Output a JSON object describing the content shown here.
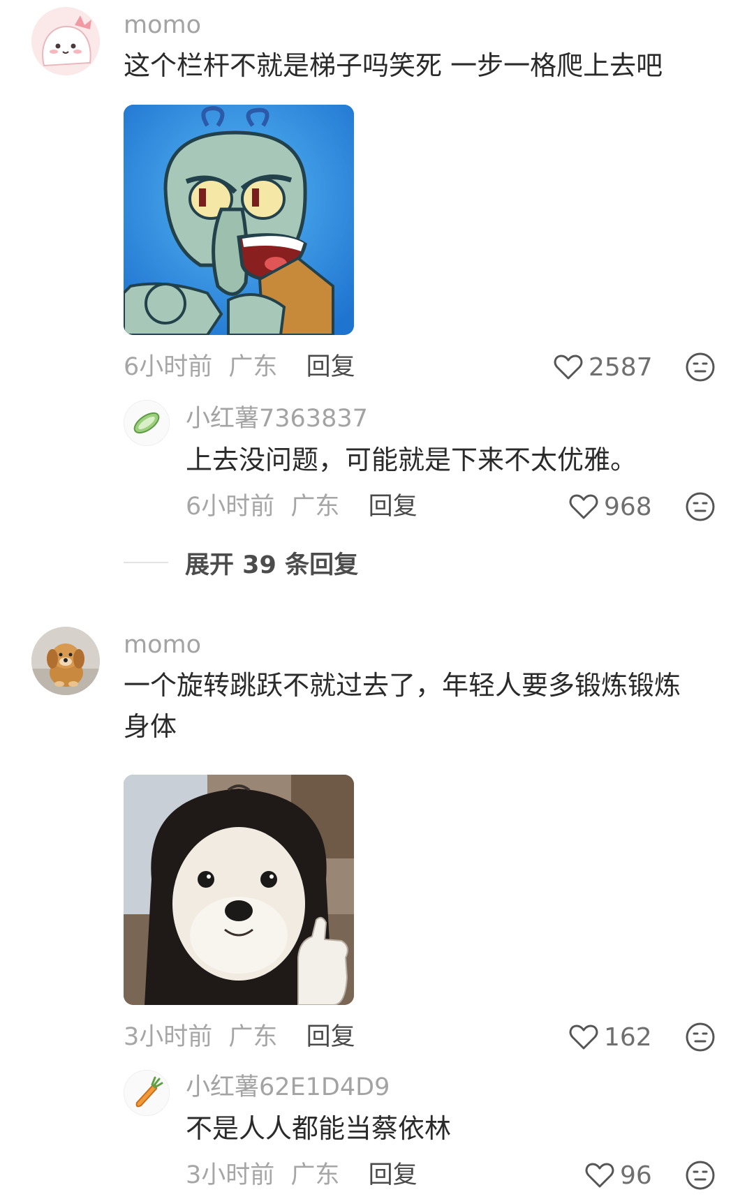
{
  "comments": [
    {
      "username": "momo",
      "text_lines": [
        "这个栏杆不就是梯子吗笑死 一步一格爬上去吧"
      ],
      "image": "squidward-meme",
      "time": "6小时前",
      "location": "广东",
      "reply_label": "回复",
      "likes": "2587",
      "replies": [
        {
          "username": "小红薯7363837",
          "avatar": "cucumber-avatar",
          "text": "上去没问题，可能就是下来不太优雅。",
          "time": "6小时前",
          "location": "广东",
          "reply_label": "回复",
          "likes": "968"
        }
      ],
      "expand_label": "展开 39 条回复"
    },
    {
      "username": "momo",
      "text_lines": [
        "一个旋转跳跃不就过去了，年轻人要多锻炼锻炼",
        "身体"
      ],
      "image": "dog-with-wig-meme",
      "time": "3小时前",
      "location": "广东",
      "reply_label": "回复",
      "likes": "162",
      "replies": [
        {
          "username": "小红薯62E1D4D9",
          "avatar": "carrot-avatar",
          "text": "不是人人都能当蔡依林",
          "time": "3小时前",
          "location": "广东",
          "reply_label": "回复",
          "likes": "96"
        }
      ]
    }
  ],
  "icons": {
    "like": "heart-outline-icon",
    "emoji": "emoji-face-icon"
  },
  "colors": {
    "username": "#a3a3a3",
    "text": "#2a2a2a",
    "meta": "#a6a6a6",
    "reply": "#4a4a4a"
  }
}
